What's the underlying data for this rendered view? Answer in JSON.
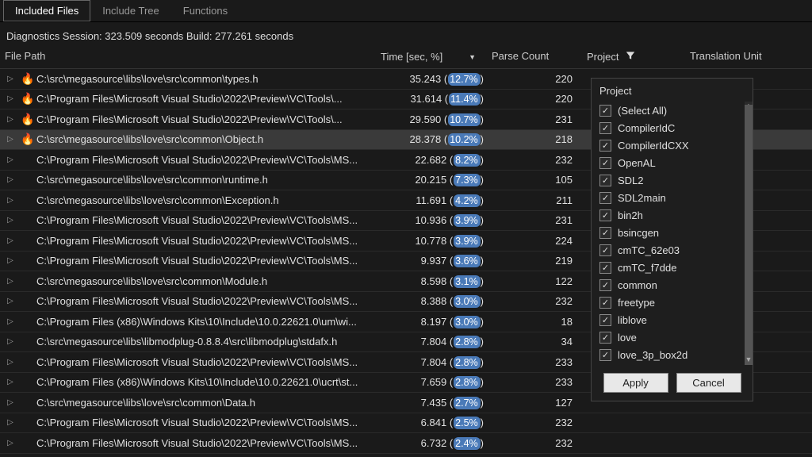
{
  "tabs": [
    {
      "label": "Included Files",
      "active": true
    },
    {
      "label": "Include Tree",
      "active": false
    },
    {
      "label": "Functions",
      "active": false
    }
  ],
  "status": "Diagnostics Session: 323.509 seconds  Build: 277.261 seconds",
  "headers": {
    "path": "File Path",
    "time": "Time [sec, %]",
    "parse": "Parse Count",
    "project": "Project",
    "tu": "Translation Unit"
  },
  "rows": [
    {
      "hot": true,
      "path": "C:\\src\\megasource\\libs\\love\\src\\common\\types.h",
      "sec": "35.243",
      "pct": "12.7%",
      "parse": "220"
    },
    {
      "hot": true,
      "path": "C:\\Program Files\\Microsoft Visual Studio\\2022\\Preview\\VC\\Tools\\...",
      "sec": "31.614",
      "pct": "11.4%",
      "parse": "220"
    },
    {
      "hot": true,
      "path": "C:\\Program Files\\Microsoft Visual Studio\\2022\\Preview\\VC\\Tools\\...",
      "sec": "29.590",
      "pct": "10.7%",
      "parse": "231"
    },
    {
      "hot": true,
      "path": "C:\\src\\megasource\\libs\\love\\src\\common\\Object.h",
      "sec": "28.378",
      "pct": "10.2%",
      "parse": "218"
    },
    {
      "hot": false,
      "path": "C:\\Program Files\\Microsoft Visual Studio\\2022\\Preview\\VC\\Tools\\MS...",
      "sec": "22.682",
      "pct": "8.2%",
      "parse": "232"
    },
    {
      "hot": false,
      "path": "C:\\src\\megasource\\libs\\love\\src\\common\\runtime.h",
      "sec": "20.215",
      "pct": "7.3%",
      "parse": "105"
    },
    {
      "hot": false,
      "path": "C:\\src\\megasource\\libs\\love\\src\\common\\Exception.h",
      "sec": "11.691",
      "pct": "4.2%",
      "parse": "211"
    },
    {
      "hot": false,
      "path": "C:\\Program Files\\Microsoft Visual Studio\\2022\\Preview\\VC\\Tools\\MS...",
      "sec": "10.936",
      "pct": "3.9%",
      "parse": "231"
    },
    {
      "hot": false,
      "path": "C:\\Program Files\\Microsoft Visual Studio\\2022\\Preview\\VC\\Tools\\MS...",
      "sec": "10.778",
      "pct": "3.9%",
      "parse": "224"
    },
    {
      "hot": false,
      "path": "C:\\Program Files\\Microsoft Visual Studio\\2022\\Preview\\VC\\Tools\\MS...",
      "sec": "9.937",
      "pct": "3.6%",
      "parse": "219"
    },
    {
      "hot": false,
      "path": "C:\\src\\megasource\\libs\\love\\src\\common\\Module.h",
      "sec": "8.598",
      "pct": "3.1%",
      "parse": "122"
    },
    {
      "hot": false,
      "path": "C:\\Program Files\\Microsoft Visual Studio\\2022\\Preview\\VC\\Tools\\MS...",
      "sec": "8.388",
      "pct": "3.0%",
      "parse": "232"
    },
    {
      "hot": false,
      "path": "C:\\Program Files (x86)\\Windows Kits\\10\\Include\\10.0.22621.0\\um\\wi...",
      "sec": "8.197",
      "pct": "3.0%",
      "parse": "18"
    },
    {
      "hot": false,
      "path": "C:\\src\\megasource\\libs\\libmodplug-0.8.8.4\\src\\libmodplug\\stdafx.h",
      "sec": "7.804",
      "pct": "2.8%",
      "parse": "34"
    },
    {
      "hot": false,
      "path": "C:\\Program Files\\Microsoft Visual Studio\\2022\\Preview\\VC\\Tools\\MS...",
      "sec": "7.804",
      "pct": "2.8%",
      "parse": "233"
    },
    {
      "hot": false,
      "path": "C:\\Program Files (x86)\\Windows Kits\\10\\Include\\10.0.22621.0\\ucrt\\st...",
      "sec": "7.659",
      "pct": "2.8%",
      "parse": "233"
    },
    {
      "hot": false,
      "path": "C:\\src\\megasource\\libs\\love\\src\\common\\Data.h",
      "sec": "7.435",
      "pct": "2.7%",
      "parse": "127"
    },
    {
      "hot": false,
      "path": "C:\\Program Files\\Microsoft Visual Studio\\2022\\Preview\\VC\\Tools\\MS...",
      "sec": "6.841",
      "pct": "2.5%",
      "parse": "232"
    },
    {
      "hot": false,
      "path": "C:\\Program Files\\Microsoft Visual Studio\\2022\\Preview\\VC\\Tools\\MS...",
      "sec": "6.732",
      "pct": "2.4%",
      "parse": "232"
    }
  ],
  "filter": {
    "title": "Project",
    "items": [
      "(Select All)",
      "CompilerIdC",
      "CompilerIdCXX",
      "OpenAL",
      "SDL2",
      "SDL2main",
      "bin2h",
      "bsincgen",
      "cmTC_62e03",
      "cmTC_f7dde",
      "common",
      "freetype",
      "liblove",
      "love",
      "love_3p_box2d"
    ],
    "apply": "Apply",
    "cancel": "Cancel"
  }
}
